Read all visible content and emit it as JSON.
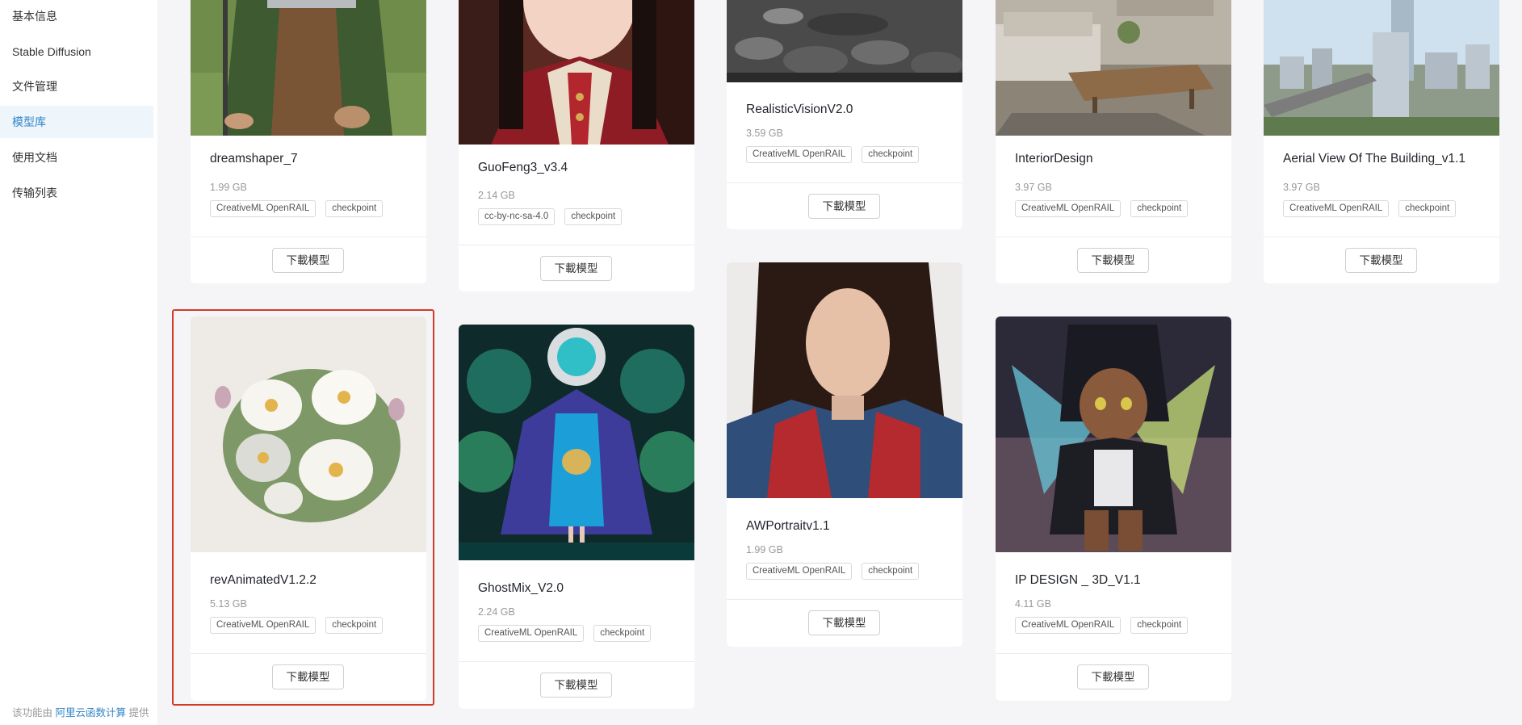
{
  "sidebar": {
    "items": [
      {
        "label": "基本信息"
      },
      {
        "label": "Stable Diffusion"
      },
      {
        "label": "文件管理"
      },
      {
        "label": "模型库"
      },
      {
        "label": "使用文档"
      },
      {
        "label": "传输列表"
      }
    ],
    "active_index": 3,
    "footer": {
      "prefix": "该功能由",
      "link": "阿里云函数计算",
      "suffix": "提供"
    }
  },
  "download_label": "下載模型",
  "accent_color": "#2f86c9",
  "highlight_color": "#d33a2c",
  "models": [
    {
      "name": "dreamshaper_7",
      "size": "1.99 GB",
      "license": "CreativeML OpenRAIL",
      "type": "checkpoint"
    },
    {
      "name": "GuoFeng3_v3.4",
      "size": "2.14 GB",
      "license": "cc-by-nc-sa-4.0",
      "type": "checkpoint"
    },
    {
      "name": "RealisticVisionV2.0",
      "size": "3.59 GB",
      "license": "CreativeML OpenRAIL",
      "type": "checkpoint"
    },
    {
      "name": "InteriorDesign",
      "size": "3.97 GB",
      "license": "CreativeML OpenRAIL",
      "type": "checkpoint"
    },
    {
      "name": "Aerial View Of The Building_v1.1",
      "size": "3.97 GB",
      "license": "CreativeML OpenRAIL",
      "type": "checkpoint"
    },
    {
      "name": "revAnimatedV1.2.2",
      "size": "5.13 GB",
      "license": "CreativeML OpenRAIL",
      "type": "checkpoint"
    },
    {
      "name": "GhostMix_V2.0",
      "size": "2.24 GB",
      "license": "CreativeML OpenRAIL",
      "type": "checkpoint"
    },
    {
      "name": "AWPortraitv1.1",
      "size": "1.99 GB",
      "license": "CreativeML OpenRAIL",
      "type": "checkpoint"
    },
    {
      "name": "IP DESIGN _ 3D_V1.1",
      "size": "4.11 GB",
      "license": "CreativeML OpenRAIL",
      "type": "checkpoint"
    }
  ]
}
